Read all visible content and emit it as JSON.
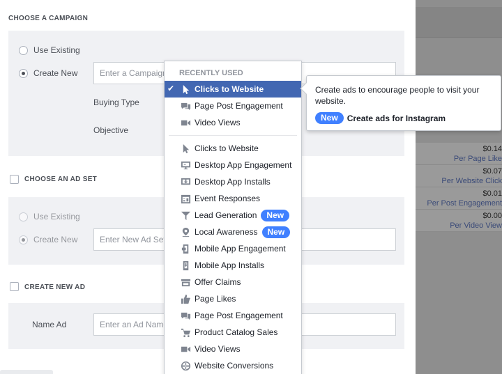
{
  "campaign": {
    "title": "CHOOSE A CAMPAIGN",
    "use_existing": "Use Existing",
    "create_new": "Create New",
    "name_placeholder": "Enter a Campaign Name",
    "buying_type_label": "Buying Type",
    "objective_label": "Objective"
  },
  "ad_set": {
    "title": "CHOOSE AN AD SET",
    "use_existing": "Use Existing",
    "create_new": "Create New",
    "name_placeholder": "Enter New Ad Set Name"
  },
  "ad": {
    "title": "CREATE NEW AD",
    "name_label": "Name Ad",
    "name_placeholder": "Enter an Ad Name"
  },
  "dropdown": {
    "header": "RECENTLY USED",
    "badge": "New",
    "recent": [
      {
        "label": "Clicks to Website",
        "icon": "cursor-icon",
        "selected": true
      },
      {
        "label": "Page Post Engagement",
        "icon": "post-engagement-icon"
      },
      {
        "label": "Video Views",
        "icon": "video-icon"
      }
    ],
    "all": [
      {
        "label": "Clicks to Website",
        "icon": "cursor-icon"
      },
      {
        "label": "Desktop App Engagement",
        "icon": "desktop-app-icon"
      },
      {
        "label": "Desktop App Installs",
        "icon": "desktop-install-icon"
      },
      {
        "label": "Event Responses",
        "icon": "calendar-icon"
      },
      {
        "label": "Lead Generation",
        "icon": "funnel-icon",
        "new": true
      },
      {
        "label": "Local Awareness",
        "icon": "location-pin-icon",
        "new": true
      },
      {
        "label": "Mobile App Engagement",
        "icon": "mobile-app-icon"
      },
      {
        "label": "Mobile App Installs",
        "icon": "mobile-install-icon"
      },
      {
        "label": "Offer Claims",
        "icon": "offer-icon"
      },
      {
        "label": "Page Likes",
        "icon": "thumbs-up-icon"
      },
      {
        "label": "Page Post Engagement",
        "icon": "post-engagement-icon"
      },
      {
        "label": "Product Catalog Sales",
        "icon": "cart-icon"
      },
      {
        "label": "Video Views",
        "icon": "video-icon"
      },
      {
        "label": "Website Conversions",
        "icon": "globe-icon"
      }
    ]
  },
  "tooltip": {
    "text": "Create ads to encourage people to visit your website.",
    "badge": "New",
    "instagram": "Create ads for Instagram"
  },
  "background_rows": [
    {
      "amount": "$0.14",
      "per": "Per Page Like"
    },
    {
      "amount": "$0.07",
      "per": "Per Website Click"
    },
    {
      "amount": "$0.01",
      "per": "Per Post Engagement"
    },
    {
      "amount": "$0.00",
      "per": "Per Video View"
    }
  ]
}
